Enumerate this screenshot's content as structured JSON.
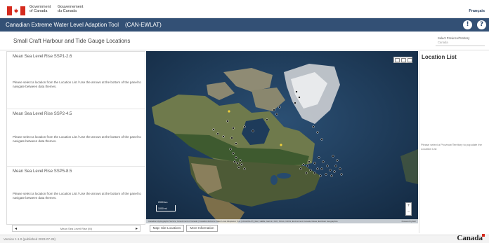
{
  "gc_header": {
    "gov_en_line1": "Government",
    "gov_en_line2": "of Canada",
    "gov_fr_line1": "Gouvernement",
    "gov_fr_line2": "du Canada",
    "language_link": "Français"
  },
  "app_bar": {
    "title": "Canadian Extreme Water Level Adaption Tool",
    "code": "(CAN-EWLAT)",
    "info_icon": "exclamation-circle-icon",
    "help_icon": "question-circle-icon"
  },
  "page": {
    "title": "Small Craft Harbour and Tide Gauge Locations",
    "province_label": "Select Province/Territory",
    "province_value": "Canada"
  },
  "left_panel": {
    "sections": [
      {
        "title": "Mean Sea Level Rise SSP1-2.6",
        "message": "Please select a location from the Location List / Use the arrows at the bottom of the panel to navigate between data themes."
      },
      {
        "title": "Mean Sea Level Rise SSP2-4.5",
        "message": "Please select a location from the Location List / Use the arrows at the bottom of the panel to navigate between data themes."
      },
      {
        "title": "Mean Sea Level Rise SSP5-8.5",
        "message": "Please select a location from the Location List / Use the arrows at the bottom of the panel to navigate between data themes."
      }
    ],
    "pager": {
      "label": "Mean Sea Level Rise (M)",
      "prev_icon": "chevron-left-icon",
      "next_icon": "chevron-right-icon"
    }
  },
  "map": {
    "scale_top": "2000 km",
    "scale_bottom": "1000 mi",
    "attribution": "Canadian Hydrographic Service, Government of Canada | Canadian Extreme Water Level Adaptation Tool (CAN-EWLAT) | Esri, HERE, Garmin, FAO, NOAA, USGS, Environment Canada, Maxar, Earthstar Geographics",
    "attribution_right": "Powered by Esri",
    "tools": [
      "layers-icon",
      "list-icon",
      "grid-icon"
    ],
    "zoom_in": "+",
    "zoom_out": "−"
  },
  "map_tabs": {
    "sites": "Map: Site Locations",
    "more": "More Information"
  },
  "right_panel": {
    "title": "Location List",
    "message": "Please select a Province/Territory to populate the Location List"
  },
  "footer": {
    "version": "Version 1.1.0 (published 2023-07-28)",
    "wordmark": "Canada"
  },
  "colors": {
    "app_bar": "#335075",
    "flag_red": "#d52b1e",
    "map_ocean": "#1f3d5e",
    "map_land": "#6f7a4c"
  }
}
